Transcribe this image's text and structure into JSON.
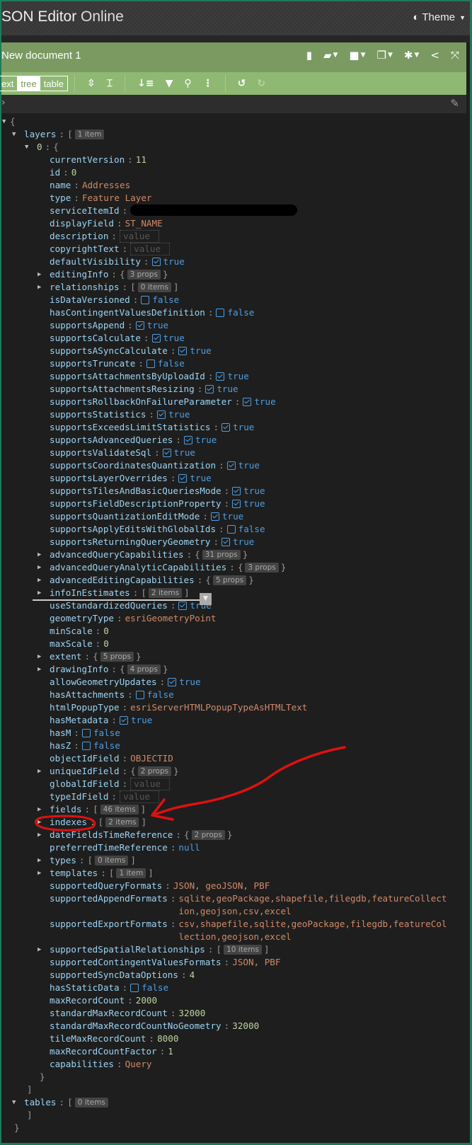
{
  "app": {
    "title_bold": "SON Editor",
    "title_light": "Online",
    "theme_label": "Theme"
  },
  "document": {
    "title": "New document 1"
  },
  "menu_icons": [
    "new-document-icon",
    "open-folder-icon",
    "save-icon",
    "copy-icon",
    "settings-icon",
    "share-icon",
    "fullscreen-icon"
  ],
  "modes": [
    "ext",
    "tree",
    "table"
  ],
  "active_mode": "tree",
  "toolbar_icons": [
    "expand-all-icon",
    "collapse-all-icon",
    "sort-icon",
    "filter-icon",
    "search-icon",
    "more-icon",
    "undo-icon",
    "redo-icon"
  ],
  "colors": {
    "menubar": "#7a9a62",
    "toolbar": "#8fb872",
    "background": "#1e1e1e",
    "key": "#9cd4f4",
    "string": "#d18a68",
    "number": "#bcd5a0",
    "boolean": "#4f9ee0",
    "annotation": "#e01010"
  },
  "tree": [
    {
      "l": 0,
      "t": "open",
      "br": "{"
    },
    {
      "l": 1,
      "t": "open",
      "k": "layers",
      "br": "[",
      "badge": "1 item"
    },
    {
      "l": 2,
      "t": "open",
      "k": "0",
      "br": "{",
      "idx": true
    },
    {
      "l": 3,
      "t": "num",
      "k": "currentVersion",
      "v": "11"
    },
    {
      "l": 3,
      "t": "num",
      "k": "id",
      "v": "0"
    },
    {
      "l": 3,
      "t": "str",
      "k": "name",
      "v": "Addresses"
    },
    {
      "l": 3,
      "t": "str",
      "k": "type",
      "v": "Feature Layer"
    },
    {
      "l": 3,
      "t": "redacted",
      "k": "serviceItemId"
    },
    {
      "l": 3,
      "t": "str",
      "k": "displayField",
      "v": "ST_NAME"
    },
    {
      "l": 3,
      "t": "empty",
      "k": "description",
      "v": "value"
    },
    {
      "l": 3,
      "t": "empty",
      "k": "copyrightText",
      "v": "value"
    },
    {
      "l": 3,
      "t": "bool",
      "k": "defaultVisibility",
      "v": "true"
    },
    {
      "l": 3,
      "t": "col",
      "k": "editingInfo",
      "br": "{",
      "cl": "}",
      "badge": "3 props"
    },
    {
      "l": 3,
      "t": "col",
      "k": "relationships",
      "br": "[",
      "cl": "]",
      "badge": "0 items"
    },
    {
      "l": 3,
      "t": "bool",
      "k": "isDataVersioned",
      "v": "false"
    },
    {
      "l": 3,
      "t": "bool",
      "k": "hasContingentValuesDefinition",
      "v": "false"
    },
    {
      "l": 3,
      "t": "bool",
      "k": "supportsAppend",
      "v": "true"
    },
    {
      "l": 3,
      "t": "bool",
      "k": "supportsCalculate",
      "v": "true"
    },
    {
      "l": 3,
      "t": "bool",
      "k": "supportsASyncCalculate",
      "v": "true"
    },
    {
      "l": 3,
      "t": "bool",
      "k": "supportsTruncate",
      "v": "false"
    },
    {
      "l": 3,
      "t": "bool",
      "k": "supportsAttachmentsByUploadId",
      "v": "true"
    },
    {
      "l": 3,
      "t": "bool",
      "k": "supportsAttachmentsResizing",
      "v": "true"
    },
    {
      "l": 3,
      "t": "bool",
      "k": "supportsRollbackOnFailureParameter",
      "v": "true"
    },
    {
      "l": 3,
      "t": "bool",
      "k": "supportsStatistics",
      "v": "true"
    },
    {
      "l": 3,
      "t": "bool",
      "k": "supportsExceedsLimitStatistics",
      "v": "true"
    },
    {
      "l": 3,
      "t": "bool",
      "k": "supportsAdvancedQueries",
      "v": "true"
    },
    {
      "l": 3,
      "t": "bool",
      "k": "supportsValidateSql",
      "v": "true"
    },
    {
      "l": 3,
      "t": "bool",
      "k": "supportsCoordinatesQuantization",
      "v": "true"
    },
    {
      "l": 3,
      "t": "bool",
      "k": "supportsLayerOverrides",
      "v": "true"
    },
    {
      "l": 3,
      "t": "bool",
      "k": "supportsTilesAndBasicQueriesMode",
      "v": "true"
    },
    {
      "l": 3,
      "t": "bool",
      "k": "supportsFieldDescriptionProperty",
      "v": "true"
    },
    {
      "l": 3,
      "t": "bool",
      "k": "supportsQuantizationEditMode",
      "v": "true"
    },
    {
      "l": 3,
      "t": "bool",
      "k": "supportsApplyEditsWithGlobalIds",
      "v": "false"
    },
    {
      "l": 3,
      "t": "bool",
      "k": "supportsReturningQueryGeometry",
      "v": "true"
    },
    {
      "l": 3,
      "t": "col",
      "k": "advancedQueryCapabilities",
      "br": "{",
      "cl": "}",
      "badge": "31 props"
    },
    {
      "l": 3,
      "t": "col",
      "k": "advancedQueryAnalyticCapabilities",
      "br": "{",
      "cl": "}",
      "badge": "3 props"
    },
    {
      "l": 3,
      "t": "col",
      "k": "advancedEditingCapabilities",
      "br": "{",
      "cl": "}",
      "badge": "5 props"
    },
    {
      "l": 3,
      "t": "col",
      "k": "infoInEstimates",
      "br": "[",
      "cl": "]",
      "badge": "2 items"
    },
    {
      "l": 3,
      "t": "bool",
      "k": "useStandardizedQueries",
      "v": "true"
    },
    {
      "l": 3,
      "t": "str",
      "k": "geometryType",
      "v": "esriGeometryPoint"
    },
    {
      "l": 3,
      "t": "num",
      "k": "minScale",
      "v": "0"
    },
    {
      "l": 3,
      "t": "num",
      "k": "maxScale",
      "v": "0"
    },
    {
      "l": 3,
      "t": "col",
      "k": "extent",
      "br": "{",
      "cl": "}",
      "badge": "5 props"
    },
    {
      "l": 3,
      "t": "col",
      "k": "drawingInfo",
      "br": "{",
      "cl": "}",
      "badge": "4 props"
    },
    {
      "l": 3,
      "t": "bool",
      "k": "allowGeometryUpdates",
      "v": "true"
    },
    {
      "l": 3,
      "t": "bool",
      "k": "hasAttachments",
      "v": "false"
    },
    {
      "l": 3,
      "t": "str",
      "k": "htmlPopupType",
      "v": "esriServerHTMLPopupTypeAsHTMLText"
    },
    {
      "l": 3,
      "t": "bool",
      "k": "hasMetadata",
      "v": "true"
    },
    {
      "l": 3,
      "t": "bool",
      "k": "hasM",
      "v": "false"
    },
    {
      "l": 3,
      "t": "bool",
      "k": "hasZ",
      "v": "false"
    },
    {
      "l": 3,
      "t": "str",
      "k": "objectIdField",
      "v": "OBJECTID"
    },
    {
      "l": 3,
      "t": "col",
      "k": "uniqueIdField",
      "br": "{",
      "cl": "}",
      "badge": "2 props"
    },
    {
      "l": 3,
      "t": "empty",
      "k": "globalIdField",
      "v": "value"
    },
    {
      "l": 3,
      "t": "empty",
      "k": "typeIdField",
      "v": "value"
    },
    {
      "l": 3,
      "t": "col",
      "k": "fields",
      "br": "[",
      "cl": "]",
      "badge": "46 items"
    },
    {
      "l": 3,
      "t": "col",
      "k": "indexes",
      "br": "[",
      "cl": "]",
      "badge": "2 items"
    },
    {
      "l": 3,
      "t": "col",
      "k": "dateFieldsTimeReference",
      "br": "{",
      "cl": "}",
      "badge": "2 props"
    },
    {
      "l": 3,
      "t": "null",
      "k": "preferredTimeReference",
      "v": "null"
    },
    {
      "l": 3,
      "t": "col",
      "k": "types",
      "br": "[",
      "cl": "]",
      "badge": "0 items"
    },
    {
      "l": 3,
      "t": "col",
      "k": "templates",
      "br": "[",
      "cl": "]",
      "badge": "1 item"
    },
    {
      "l": 3,
      "t": "str",
      "k": "supportedQueryFormats",
      "v": "JSON, geoJSON, PBF"
    },
    {
      "l": 3,
      "t": "str",
      "k": "supportedAppendFormats",
      "v": "sqlite,geoPackage,shapefile,filegdb,featureCollection,geojson,csv,excel",
      "wrap": true
    },
    {
      "l": 3,
      "t": "str",
      "k": "supportedExportFormats",
      "v": "csv,shapefile,sqlite,geoPackage,filegdb,featureCollection,geojson,excel",
      "wrap": true
    },
    {
      "l": 3,
      "t": "col",
      "k": "supportedSpatialRelationships",
      "br": "[",
      "cl": "]",
      "badge": "10 items"
    },
    {
      "l": 3,
      "t": "str",
      "k": "supportedContingentValuesFormats",
      "v": "JSON, PBF"
    },
    {
      "l": 3,
      "t": "num",
      "k": "supportedSyncDataOptions",
      "v": "4"
    },
    {
      "l": 3,
      "t": "bool",
      "k": "hasStaticData",
      "v": "false"
    },
    {
      "l": 3,
      "t": "num",
      "k": "maxRecordCount",
      "v": "2000"
    },
    {
      "l": 3,
      "t": "num",
      "k": "standardMaxRecordCount",
      "v": "32000"
    },
    {
      "l": 3,
      "t": "num",
      "k": "standardMaxRecordCountNoGeometry",
      "v": "32000"
    },
    {
      "l": 3,
      "t": "num",
      "k": "tileMaxRecordCount",
      "v": "8000"
    },
    {
      "l": 3,
      "t": "num",
      "k": "maxRecordCountFactor",
      "v": "1"
    },
    {
      "l": 3,
      "t": "str",
      "k": "capabilities",
      "v": "Query"
    },
    {
      "l": 2,
      "t": "close",
      "br": "}"
    },
    {
      "l": 1,
      "t": "close",
      "br": "]"
    },
    {
      "l": 1,
      "t": "open",
      "k": "tables",
      "br": "[",
      "badge": "0 items"
    },
    {
      "l": 1,
      "t": "close",
      "br": "]"
    },
    {
      "l": 0,
      "t": "close",
      "br": "}"
    }
  ]
}
